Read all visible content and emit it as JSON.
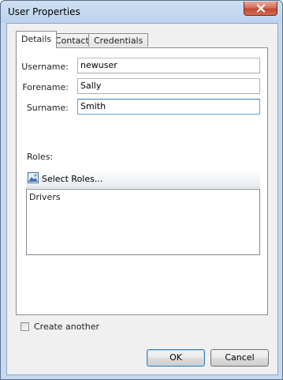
{
  "window": {
    "title": "User Properties"
  },
  "tabs": [
    {
      "label": "Details",
      "active": true
    },
    {
      "label": "Contact",
      "active": false
    },
    {
      "label": "Credentials",
      "active": false
    }
  ],
  "details": {
    "username": {
      "label": "Username:",
      "value": "newuser"
    },
    "forename": {
      "label": "Forename:",
      "value": "Sally"
    },
    "surname": {
      "label": "Surname:",
      "value": "Smith"
    }
  },
  "roles": {
    "label": "Roles:",
    "select_button": "Select Roles...",
    "items": [
      "Drivers"
    ]
  },
  "create_another": {
    "label": "Create another",
    "checked": false
  },
  "buttons": {
    "ok": "OK",
    "cancel": "Cancel"
  },
  "icons": {
    "close": "close-icon",
    "select_roles": "select-roles-icon"
  },
  "colors": {
    "close_button": "#c24a33",
    "title_bar": "#bcd3ee",
    "focus_border": "#5fa4d8"
  }
}
